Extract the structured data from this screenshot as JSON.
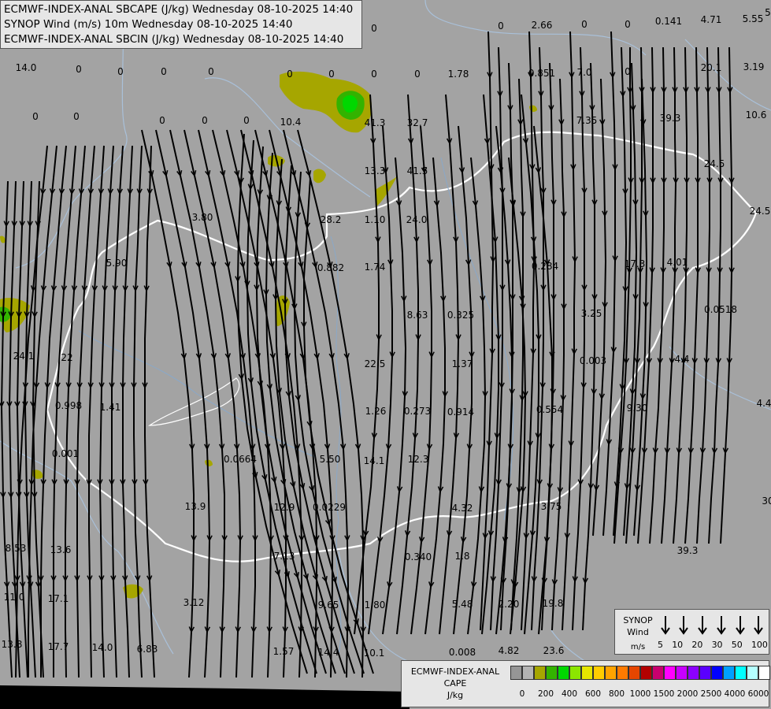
{
  "titles": [
    "ECMWF-INDEX-ANAL SBCAPE (J/kg) Wednesday 08-10-2025 14:40",
    "SYNOP Wind (m/s) 10m Wednesday 08-10-2025 14:40",
    "ECMWF-INDEX-ANAL SBCIN (J/kg) Wednesday 08-10-2025 14:40"
  ],
  "synop_legend": {
    "title_line1": "SYNOP",
    "title_line2": "Wind",
    "unit": "m/s",
    "values": [
      "5",
      "10",
      "20",
      "30",
      "50",
      "100"
    ]
  },
  "cape_legend": {
    "title_line1": "ECMWF-INDEX-ANAL",
    "title_line2": "CAPE",
    "unit": "J/kg",
    "colors": [
      "#969696",
      "#b4b4b4",
      "#a6a600",
      "#33b300",
      "#00d700",
      "#8ce600",
      "#e6e600",
      "#ffcc00",
      "#ffa300",
      "#ff7a00",
      "#e64600",
      "#b30000",
      "#c8006e",
      "#ff00ff",
      "#c800ff",
      "#8c00ff",
      "#5a00ff",
      "#0000ff",
      "#00a0ff",
      "#00ffff",
      "#b4ffff",
      "#ffffff"
    ],
    "ticks": [
      "0",
      "200",
      "400",
      "600",
      "800",
      "1000",
      "1500",
      "2000",
      "2500",
      "4000",
      "6000"
    ]
  },
  "values": [
    "14.0",
    "0",
    "0",
    "0",
    "0",
    "0",
    "0",
    "0",
    "0",
    "0",
    "0",
    "0",
    "0",
    "0",
    "0",
    "0",
    "0",
    "2.66",
    "0",
    "0",
    "0.141",
    "4.71",
    "5.55",
    "1.78",
    "0.851",
    "7.0",
    "20.1",
    "3.19",
    "10.4",
    "41.3",
    "32.7",
    "7.35",
    "39.3",
    "10.6",
    "13.3",
    "41.5",
    "24.5",
    "3.80",
    "28.2",
    "1.10",
    "24.0",
    "24.5",
    "5.90",
    "0.882",
    "1.74",
    "0.284",
    "17.3",
    "4.01",
    "8.63",
    "0.325",
    "3.25",
    "0.0518",
    "22.5",
    "1.37",
    "0.003",
    "4.4",
    "24.1",
    "22",
    "0.998",
    "1.41",
    "1.26",
    "0.273",
    "0.914",
    "0.554",
    "9.30",
    "4.4",
    "0.001",
    "0.0664",
    "5.50",
    "14.1",
    "12.3",
    "30",
    "13.9",
    "12.9",
    "0.0229",
    "4.32",
    "3.75",
    "8.53",
    "13.6",
    "7.13",
    "0.340",
    "1.8",
    "39.3",
    "11.0",
    "17.1",
    "3.12",
    "9.65",
    "1.80",
    "5.48",
    "2.20",
    "19.8",
    "13.8",
    "17.7",
    "14.0",
    "6.83",
    "1.57",
    "14.4",
    "10.1",
    "0.008",
    "4.82",
    "23.6",
    "5"
  ]
}
